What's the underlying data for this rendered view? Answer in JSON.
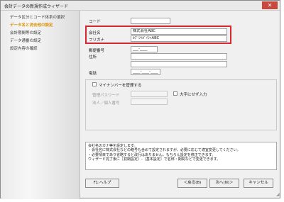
{
  "window": {
    "title": "会計データの新規作成ウィザード",
    "close_symbol": "✕"
  },
  "steps": [
    {
      "label": "データ区分とコード体系の選択",
      "active": false
    },
    {
      "label": "データ名と消去他の設定",
      "active": true
    },
    {
      "label": "会計期間等の設定",
      "active": false
    },
    {
      "label": "データ通番の設定",
      "active": false
    },
    {
      "label": "設定内容の確認",
      "active": false
    }
  ],
  "form": {
    "code_label": "コード",
    "code_value": "",
    "company_label": "会社名",
    "company_value": "株式会社ABC",
    "furigana_label": "フリガナ",
    "furigana_value": "ｶﾌﾞｼｷｶﾞｲｼｬABC",
    "postal_label": "郵便番号",
    "postal_value": "___-____",
    "address_label": "住所",
    "address1_value": "",
    "address2_value": "",
    "phone_label": "電話",
    "phone_value": "____-____-____"
  },
  "mynumber": {
    "checkbox_label": "マイナンバーを管理する",
    "password_label": "管理パスワード",
    "password_value": "",
    "corp_number_label": "法人／個人番号",
    "corp_number_value": "",
    "uppercase_label": "大字にせず入力"
  },
  "info_lines": [
    "会社名のカナ等を設定します。",
    "・会社名に株式会社などの略号も含めて設定されますが、必要に応じて適宜変更してください。",
    "・必要項目であり省略すると改行はありません。もちろん設定を修正できます。",
    "ウィザード完了後に［初期設定］-［基本設定］で名称・期間などで変更できます。"
  ],
  "buttons": {
    "help": "F1:ヘルプ",
    "back": "＜戻る(B)",
    "next": "次へ(N)＞",
    "cancel": "キャンセル"
  }
}
